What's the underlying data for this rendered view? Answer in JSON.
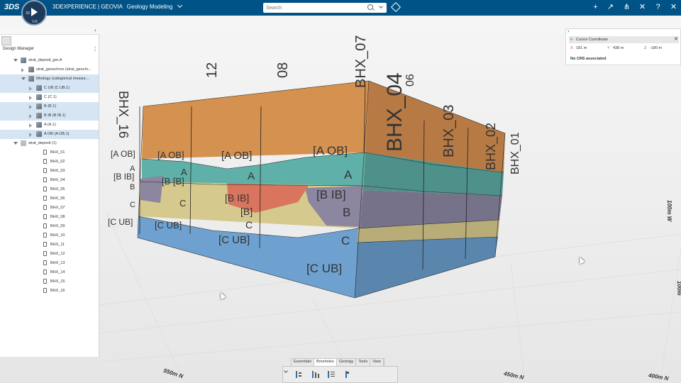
{
  "topbar": {
    "brand_logo": "3DS",
    "app_brand": "3DEXPERIENCE | GEOVIA",
    "app_name": "Geology Modeling",
    "search_placeholder": "Search",
    "compass_labels": [
      "3D",
      "V,R"
    ],
    "icons": [
      "add-icon",
      "share-arrow-icon",
      "share-icon",
      "tools-icon",
      "help-icon",
      "close-icon"
    ]
  },
  "design_manager": {
    "title": "Design Manager",
    "tree": [
      {
        "label": "strat_deposit_gm.A",
        "level": 0,
        "open": true,
        "icon": "cube",
        "selected": false
      },
      {
        "label": "strat_geoschron (strat_geochr...",
        "level": 1,
        "open": false,
        "icon": "cube",
        "selected": false
      },
      {
        "label": "lithology (categorical measur...",
        "level": 1,
        "open": true,
        "icon": "cube",
        "selected": true
      },
      {
        "label": "C UB (C UB.1)",
        "level": 2,
        "open": false,
        "icon": "cube",
        "selected": true
      },
      {
        "label": "C (C.1)",
        "level": 2,
        "open": false,
        "icon": "cube",
        "selected": false
      },
      {
        "label": "B (B.1)",
        "level": 2,
        "open": false,
        "icon": "cube",
        "selected": true
      },
      {
        "label": "B IB (B IB.1)",
        "level": 2,
        "open": false,
        "icon": "cube",
        "selected": true
      },
      {
        "label": "A (A.1)",
        "level": 2,
        "open": false,
        "icon": "cube",
        "selected": false
      },
      {
        "label": "A OB (A OB.1)",
        "level": 2,
        "open": false,
        "icon": "cube",
        "selected": true
      },
      {
        "label": "strat_deposit (1)",
        "level": 0,
        "open": true,
        "icon": "folder",
        "selected": false
      },
      {
        "label": "BHX_01",
        "level": 1,
        "icon": "bh"
      },
      {
        "label": "BHX_02",
        "level": 1,
        "icon": "bh"
      },
      {
        "label": "BHX_03",
        "level": 1,
        "icon": "bh"
      },
      {
        "label": "BHX_04",
        "level": 1,
        "icon": "bh"
      },
      {
        "label": "BHX_05",
        "level": 1,
        "icon": "bh"
      },
      {
        "label": "BHX_06",
        "level": 1,
        "icon": "bh"
      },
      {
        "label": "BHX_07",
        "level": 1,
        "icon": "bh"
      },
      {
        "label": "BHX_08",
        "level": 1,
        "icon": "bh"
      },
      {
        "label": "BHX_09",
        "level": 1,
        "icon": "bh"
      },
      {
        "label": "BHX_10",
        "level": 1,
        "icon": "bh"
      },
      {
        "label": "BHX_11",
        "level": 1,
        "icon": "bh"
      },
      {
        "label": "BHX_12",
        "level": 1,
        "icon": "bh"
      },
      {
        "label": "BHX_13",
        "level": 1,
        "icon": "bh"
      },
      {
        "label": "BHX_14",
        "level": 1,
        "icon": "bh"
      },
      {
        "label": "BHX_15",
        "level": 1,
        "icon": "bh"
      },
      {
        "label": "BHX_16",
        "level": 1,
        "icon": "bh"
      }
    ]
  },
  "cursor_coordinate": {
    "title": "Cursor Coordinate",
    "x_label": "X",
    "x_value": "181 m",
    "y_label": "Y",
    "y_value": "438 m",
    "z_label": "Z",
    "z_value": "-180 m",
    "crs_status": "No CRS associated"
  },
  "viewport": {
    "ground_labels": [
      "550m N",
      "500m N",
      "450m N",
      "400m N",
      "100m W",
      "100m"
    ],
    "borehole_labels": [
      "BHX_16",
      "12",
      "08",
      "BHX_07",
      "BHX_04",
      "06",
      "BHX_03",
      "BHX_02",
      "BHX_01"
    ],
    "unit_labels": {
      "left": [
        "[A OB]",
        "A",
        "[B IB]",
        "B",
        "C",
        "[C UB]"
      ],
      "front_a": [
        "[A OB]",
        "A",
        "[B [B]",
        "C",
        "[C UB]"
      ],
      "front_b": [
        "[A OB]",
        "A",
        "[B IB]",
        "[B]",
        "C",
        "[C UB]"
      ],
      "center": [
        "[A OB]",
        "A",
        "[B IB]",
        "B",
        "C",
        "[C UB]"
      ]
    },
    "colors": {
      "a_ob": "#d5914f",
      "a": "#5fb0a8",
      "b_ib": "#8c86a0",
      "b_red": "#d9755f",
      "b": "#d5c98e",
      "c_ub": "#6ea1cf"
    }
  },
  "bottom_toolbar": {
    "tabs": [
      "Essentials",
      "Boreholes",
      "Geology",
      "Tools",
      "View"
    ],
    "active_tab": "Boreholes",
    "tools": [
      "borehole-tool-icon",
      "borehole-group-icon",
      "borehole-table-icon",
      "borehole-single-icon"
    ]
  }
}
